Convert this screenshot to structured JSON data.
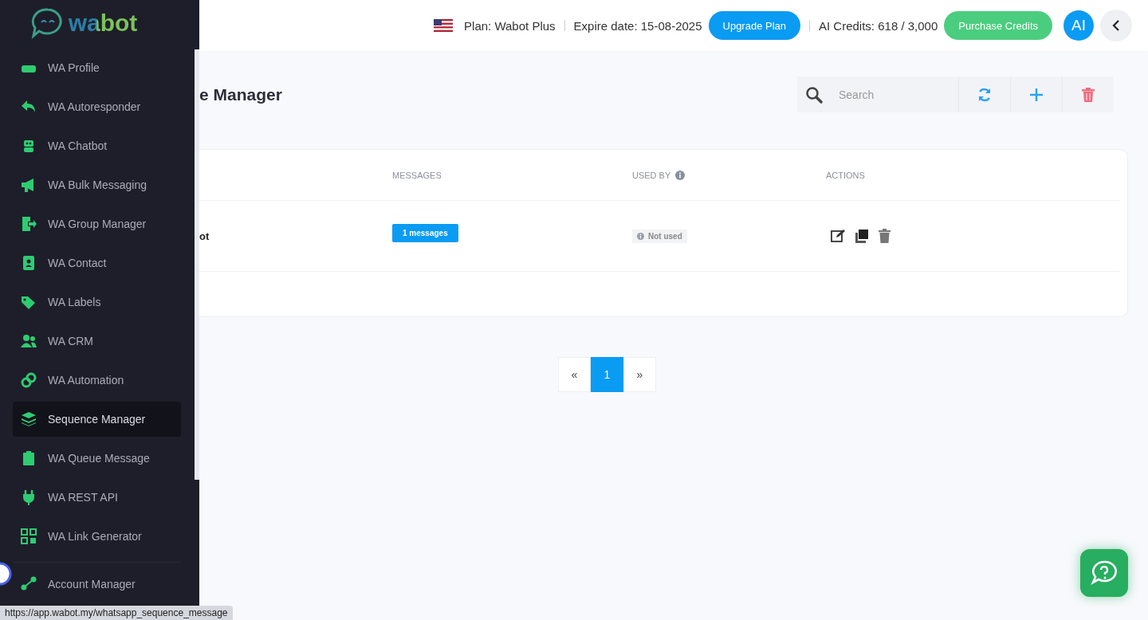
{
  "header": {
    "plan": "Plan: Wabot Plus",
    "expire": "Expire date: 15-08-2025",
    "upgrade_button": "Upgrade Plan",
    "credits": "AI Credits: 618 / 3,000",
    "purchase_button": "Purchase Credits",
    "avatar": "AI"
  },
  "sidebar": {
    "logo": "wabot",
    "items": [
      {
        "label": "WA Profile",
        "selected": false
      },
      {
        "label": "WA Autoresponder",
        "selected": false
      },
      {
        "label": "WA Chatbot",
        "selected": false
      },
      {
        "label": "WA Bulk Messaging",
        "selected": false
      },
      {
        "label": "WA Group Manager",
        "selected": false
      },
      {
        "label": "WA Contact",
        "selected": false
      },
      {
        "label": "WA Labels",
        "selected": false
      },
      {
        "label": "WA CRM",
        "selected": false
      },
      {
        "label": "WA Automation",
        "selected": false
      },
      {
        "label": "Sequence Manager",
        "selected": true
      },
      {
        "label": "WA Queue Message",
        "selected": false
      },
      {
        "label": "WA REST API",
        "selected": false
      },
      {
        "label": "WA Link Generator",
        "selected": false
      },
      {
        "label": "Account Manager",
        "selected": false
      }
    ]
  },
  "page": {
    "title": "e Manager",
    "search": {
      "placeholder": "Search"
    }
  },
  "table": {
    "columns": [
      "MESSAGES",
      "USED BY",
      "ACTIONS"
    ],
    "rows": [
      {
        "column_1": "ot",
        "messages": "1 messages",
        "used_by": "Not used"
      }
    ]
  },
  "pagination": {
    "prev": "«",
    "pages": [
      {
        "label": "1",
        "selected": true
      }
    ],
    "next": "»"
  },
  "status_url": "https://app.wabot.my/whatsapp_sequence_message"
}
